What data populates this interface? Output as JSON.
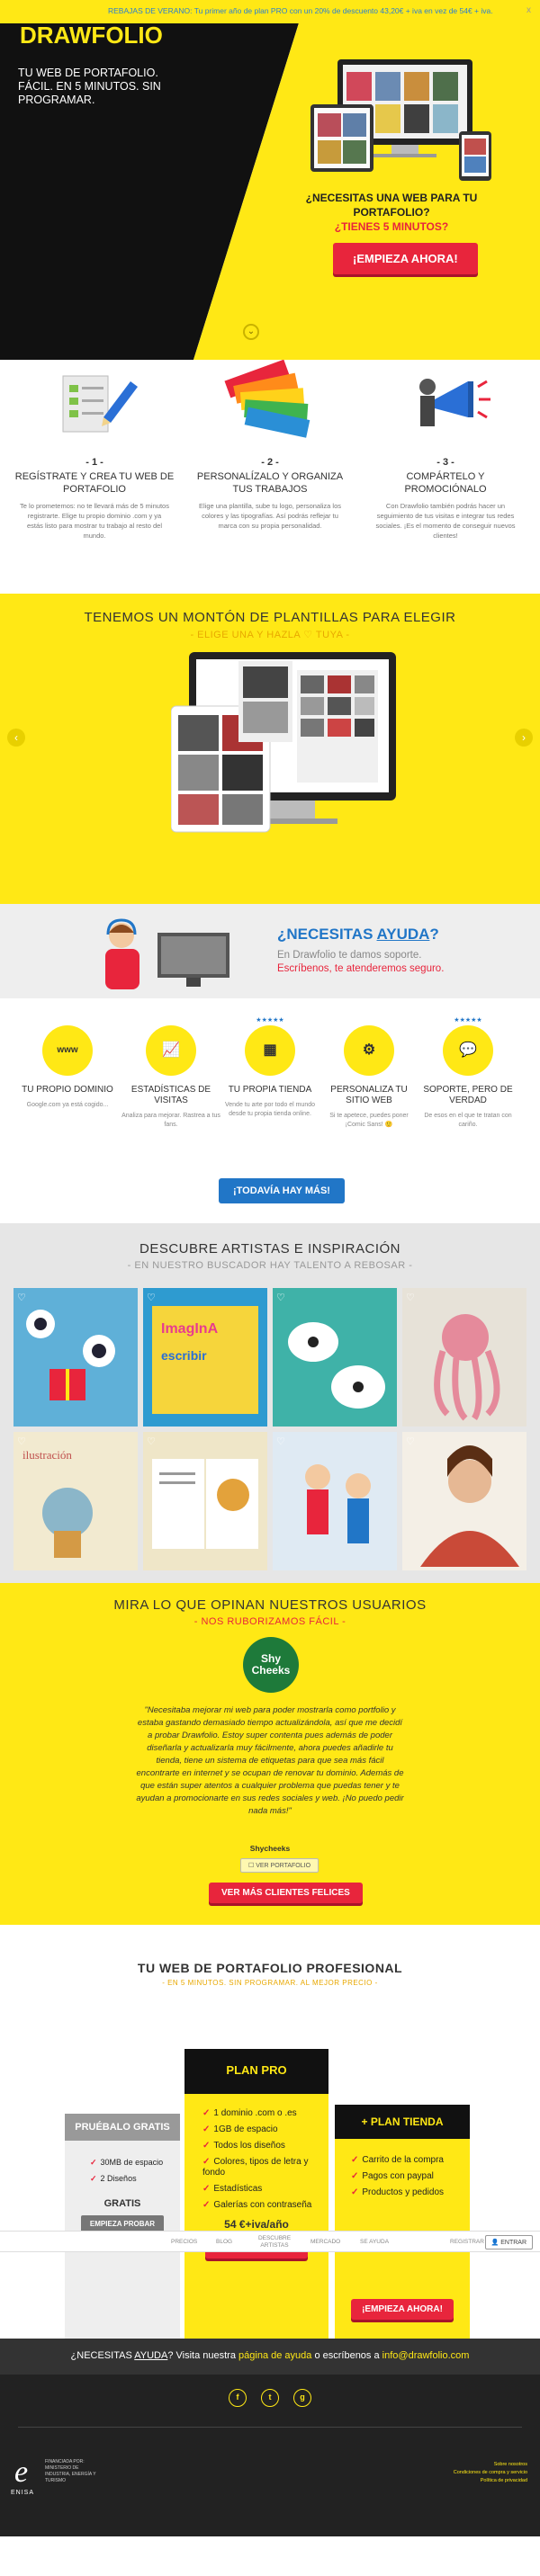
{
  "topbar": {
    "promo": "REBAJAS DE VERANO: Tu primer año de plan PRO con un 20% de descuento 43,20€ + iva en vez de 54€ + iva.",
    "close": "x"
  },
  "hero": {
    "logo": "DRAWFOLIO",
    "tagline": "TU WEB DE PORTAFOLIO. FÁCIL. EN 5 MINUTOS. SIN PROGRAMAR.",
    "question": "¿NECESITAS UNA WEB PARA TU PORTAFOLIO?",
    "question_highlight": "¿TIENES 5 MINUTOS?",
    "cta": "¡EMPIEZA AHORA!",
    "scroll": "⌄"
  },
  "steps": [
    {
      "num": "- 1 -",
      "title": "REGÍSTRATE Y CREA TU WEB DE PORTAFOLIO",
      "desc": "Te lo prometemos: no te llevará más de 5 minutos registrarte. Elige tu propio dominio .com y ya estás listo para mostrar tu trabajo al resto del mundo."
    },
    {
      "num": "- 2 -",
      "title": "PERSONALÍZALO Y ORGANIZA TUS TRABAJOS",
      "desc": "Elige una plantilla, sube tu logo, personaliza los colores y las tipografías. Así podrás reflejar tu marca con su propia personalidad."
    },
    {
      "num": "- 3 -",
      "title": "COMPÁRTELO Y PROMOCIÓNALO",
      "desc": "Con Drawfolio también podrás hacer un seguimiento de tus visitas e integrar tus redes sociales. ¡Es el momento de conseguir nuevos clientes!"
    }
  ],
  "templates": {
    "title": "TENEMOS UN MONTÓN DE PLANTILLAS PARA ELEGIR",
    "subtitle": "- ELIGE UNA Y HAZLA ♡ TUYA -",
    "prev": "‹",
    "next": "›"
  },
  "help": {
    "question_pre": "¿NECESITAS ",
    "question_link": "AYUDA",
    "question_post": "?",
    "line1": "En Drawfolio te damos soporte.",
    "line2_link": "Escríbenos",
    "line2_rest": ", te atenderemos seguro."
  },
  "features": {
    "items": [
      {
        "icon": "www",
        "title": "TU PROPIO DOMINIO",
        "desc": "Google.com ya está cogido..."
      },
      {
        "icon": "📈",
        "title": "ESTADÍSTICAS DE VISITAS",
        "desc": "Analiza para mejorar. Rastrea a tus fans."
      },
      {
        "icon": "▦",
        "title": "TU PROPIA TIENDA",
        "desc": "Vende tu arte por todo el mundo desde tu propia tienda online."
      },
      {
        "icon": "⚙",
        "title": "PERSONALIZA TU SITIO WEB",
        "desc": "Si te apetece, puedes poner ¡Comic Sans! 🙂"
      },
      {
        "icon": "💬",
        "title": "SOPORTE, PERO DE VERDAD",
        "desc": "De esos en el que te tratan con cariño."
      }
    ],
    "stars": "★★★★★",
    "more": "¡TODAVÍA HAY MÁS!"
  },
  "discover": {
    "title": "DESCUBRE ARTISTAS E INSPIRACIÓN",
    "subtitle": "- EN NUESTRO BUSCADOR HAY TALENTO A REBOSAR -",
    "heart": "♡"
  },
  "testimonials": {
    "title": "MIRA LO QUE OPINAN NUESTROS USUARIOS",
    "subtitle": "- NOS RUBORIZAMOS FÁCIL -",
    "badge": "Shy Cheeks",
    "quote": "\"Necesitaba mejorar mi web para poder mostrarla como portfolio y estaba gastando demasiado tiempo actualizándola, así que me decidí a probar Drawfolio. Estoy super contenta pues además de poder diseñarla y actualizarla muy fácilmente, ahora puedes añadirle tu tienda, tiene un sistema de etiquetas para que sea más fácil encontrarte en internet y se ocupan de renovar tu dominio. Además de que están super atentos a cualquier problema que puedas tener y te ayudan a promocionarte en sus redes sociales y web. ¡No puedo pedir nada más!\"",
    "author": "Shycheeks",
    "portfolio_btn": "☐ VER PORTAFOLIO",
    "more": "VER MÁS CLIENTES FELICES"
  },
  "pricing": {
    "title": "TU WEB DE PORTAFOLIO PROFESIONAL",
    "subtitle": "- EN 5 MINUTOS. SIN PROGRAMAR. AL MEJOR PRECIO -",
    "free": {
      "name": "PRUÉBALO GRATIS",
      "items": [
        "30MB de espacio",
        "2 Diseños"
      ],
      "label": "GRATIS",
      "cta": "EMPIEZA PROBAR"
    },
    "pro": {
      "name": "PLAN PRO",
      "items": [
        "1 dominio .com o .es",
        "1GB de espacio",
        "Todos los diseños",
        "Colores, tipos de letra y fondo",
        "Estadísticas",
        "Galerías con contraseña"
      ],
      "price": "54 €+iva/año",
      "cta": "¡EMPIEZA AHORA!"
    },
    "store": {
      "name": "+ PLAN TIENDA",
      "items": [
        "Carrito de la compra",
        "Pagos con paypal",
        "Productos y pedidos"
      ],
      "cta": "¡EMPIEZA AHORA!"
    }
  },
  "navbar": {
    "items": [
      "PRECIOS",
      "BLOG",
      "DESCUBRE ARTISTAS",
      "MERCADO",
      "SE AYUDA"
    ],
    "register": "REGISTRAR",
    "enter_label": "ENTRAR"
  },
  "contact": {
    "pre": "¿NECESITAS ",
    "help": "AYUDA",
    "mid": "? Visita nuestra ",
    "page": "página de ayuda",
    "or": " o escríbenos a ",
    "email": "info@drawfolio.com"
  },
  "footer": {
    "social": [
      "f",
      "t",
      "g"
    ],
    "enisa_logo": "e",
    "enisa": "ENISA",
    "ministry": "FINANCIADA POR: MINISTERIO DE INDUSTRIA, ENERGÍA Y TURISMO",
    "links": [
      "Sobre nosotros",
      "Condiciones de compra y servicio",
      "Política de privacidad"
    ]
  },
  "colors": {
    "accent": "#ffe815",
    "cta": "#e8253c",
    "link": "#2176c7",
    "dark": "#111111"
  }
}
